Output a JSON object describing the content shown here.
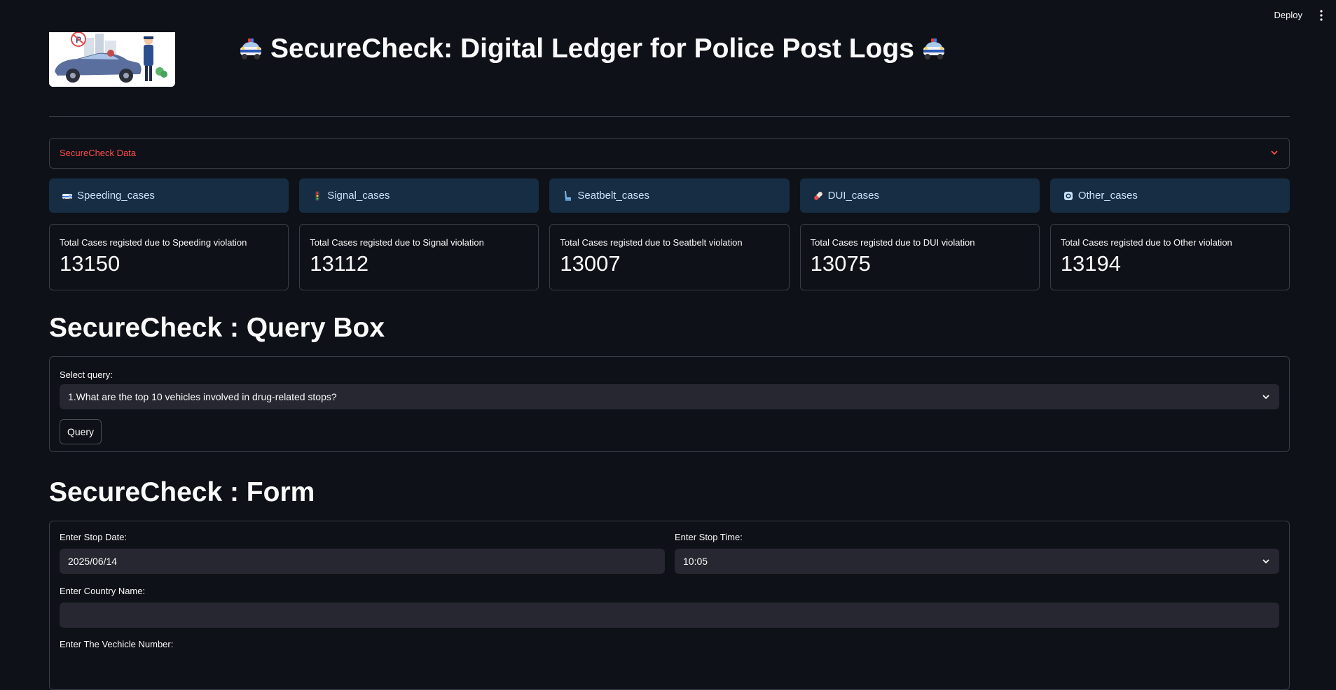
{
  "topbar": {
    "deploy_label": "Deploy",
    "menu_icon": "kebab-menu-icon"
  },
  "header": {
    "title": "SecureCheck: Digital Ledger for Police Post Logs",
    "title_icon": "police-car-icon",
    "logo_icon": "traffic-police-illustration"
  },
  "expander": {
    "label": "SecureCheck Data",
    "icon": "chevron-down-icon",
    "label_color": "#ff4b4b"
  },
  "tabs": [
    {
      "label": "Speeding_cases",
      "icon": "ambulance-icon"
    },
    {
      "label": "Signal_cases",
      "icon": "traffic-light-icon"
    },
    {
      "label": "Seatbelt_cases",
      "icon": "seat-icon"
    },
    {
      "label": "DUI_cases",
      "icon": "pill-icon"
    },
    {
      "label": "Other_cases",
      "icon": "radio-button-icon"
    }
  ],
  "metrics": [
    {
      "label": "Total Cases registed due to Speeding violation",
      "value": "13150"
    },
    {
      "label": "Total Cases registed due to Signal violation",
      "value": "13112"
    },
    {
      "label": "Total Cases registed due to Seatbelt violation",
      "value": "13007"
    },
    {
      "label": "Total Cases registed due to DUI violation",
      "value": "13075"
    },
    {
      "label": "Total Cases registed due to Other violation",
      "value": "13194"
    }
  ],
  "query_section": {
    "title": "SecureCheck : Query Box",
    "select_label": "Select query:",
    "select_value": "1.What are the top 10 vehicles involved in drug-related stops?",
    "button_label": "Query"
  },
  "form_section": {
    "title": "SecureCheck : Form",
    "stop_date_label": "Enter Stop Date:",
    "stop_date_value": "2025/06/14",
    "stop_time_label": "Enter Stop Time:",
    "stop_time_value": "10:05",
    "country_label": "Enter Country Name:",
    "country_value": "",
    "vehicle_label": "Enter The Vechicle Number:"
  },
  "colors": {
    "background": "#0e1117",
    "tab_background": "#172d43",
    "tab_text": "#c7e2fb",
    "input_background": "#262730",
    "border": "#3a3d45",
    "accent": "#ff4b4b"
  }
}
